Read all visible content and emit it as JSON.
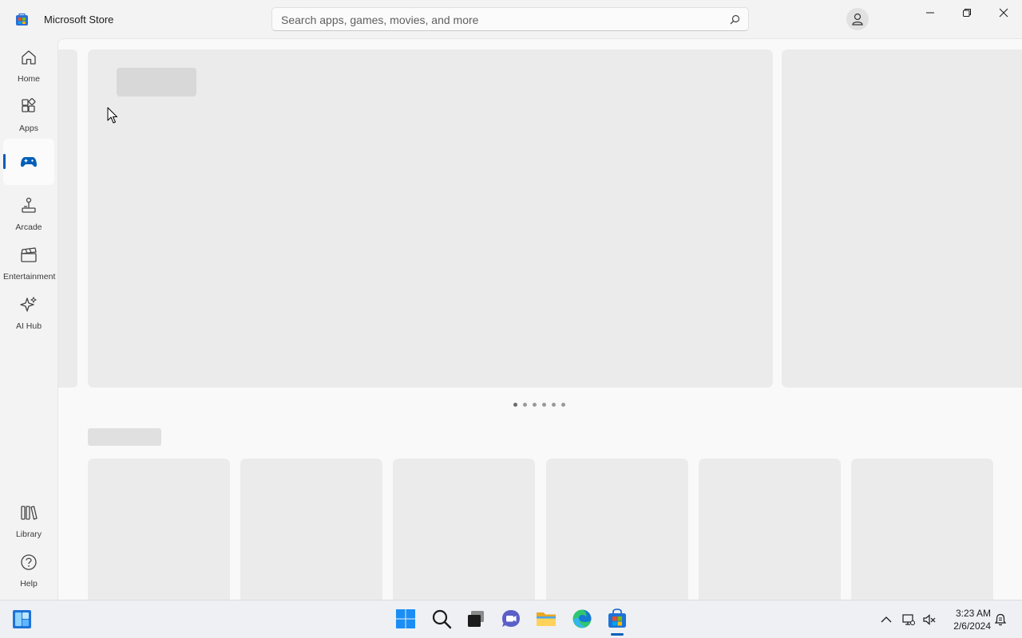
{
  "app": {
    "title": "Microsoft Store"
  },
  "search": {
    "placeholder": "Search apps, games, movies, and more",
    "icon": "search-icon"
  },
  "window_controls": [
    "minimize-icon",
    "restore-icon",
    "close-icon"
  ],
  "sidebar": {
    "items": [
      {
        "label": "Home",
        "icon": "home-icon"
      },
      {
        "label": "Apps",
        "icon": "apps-icon"
      },
      {
        "label": "",
        "icon": "gamepad-icon",
        "active": true
      },
      {
        "label": "Arcade",
        "icon": "joystick-icon"
      },
      {
        "label": "Entertainment",
        "icon": "clapperboard-icon"
      },
      {
        "label": "AI Hub",
        "icon": "sparkle-icon"
      },
      {
        "label": "Library",
        "icon": "library-icon"
      },
      {
        "label": "Help",
        "icon": "help-icon"
      }
    ]
  },
  "carousel": {
    "dot_count": 6,
    "active_index": 0
  },
  "cards": {
    "count": 6
  },
  "taskbar": {
    "apps": [
      "start-icon",
      "search-icon",
      "task-view-icon",
      "teams-chat-icon",
      "file-explorer-icon",
      "edge-icon",
      "store-icon"
    ],
    "tray": [
      "chevron-up-icon",
      "network-icon",
      "volume-muted-icon",
      "notification-icon"
    ],
    "time": "3:23 AM",
    "date": "2/6/2024"
  },
  "colors": {
    "accent": "#005fb8",
    "background": "#f3f3f3",
    "placeholder": "#ebebeb"
  }
}
